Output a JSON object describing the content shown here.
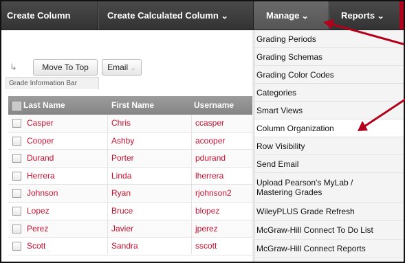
{
  "toolbar": {
    "create_column": "Create Column",
    "create_calculated_column": "Create Calculated Column",
    "manage": "Manage",
    "reports": "Reports"
  },
  "actions": {
    "move_to_top": "Move To Top",
    "email": "Email"
  },
  "grade_information_bar": "Grade Information Bar",
  "grid": {
    "columns": [
      "Last Name",
      "First Name",
      "Username"
    ],
    "rows": [
      {
        "last": "Casper",
        "first": "Chris",
        "user": "ccasper"
      },
      {
        "last": "Cooper",
        "first": "Ashby",
        "user": "acooper"
      },
      {
        "last": "Durand",
        "first": "Porter",
        "user": "pdurand"
      },
      {
        "last": "Herrera",
        "first": "Linda",
        "user": "lherrera"
      },
      {
        "last": "Johnson",
        "first": "Ryan",
        "user": "rjohnson2"
      },
      {
        "last": "Lopez",
        "first": "Bruce",
        "user": "blopez"
      },
      {
        "last": "Perez",
        "first": "Javier",
        "user": "jperez"
      },
      {
        "last": "Scott",
        "first": "Sandra",
        "user": "sscott"
      }
    ]
  },
  "manage_menu": {
    "items": [
      "Grading Periods",
      "Grading Schemas",
      "Grading Color Codes",
      "Categories",
      "Smart Views",
      "Column Organization",
      "Row Visibility",
      "Send Email",
      "Upload Pearson's MyLab / Mastering Grades",
      "WileyPLUS Grade Refresh",
      "McGraw-Hill Connect To Do List",
      "McGraw-Hill Connect Reports"
    ]
  },
  "colors": {
    "link_red": "#c8102e",
    "annotation_red": "#b3001b",
    "toolbar_dark": "#3a3a3a"
  }
}
